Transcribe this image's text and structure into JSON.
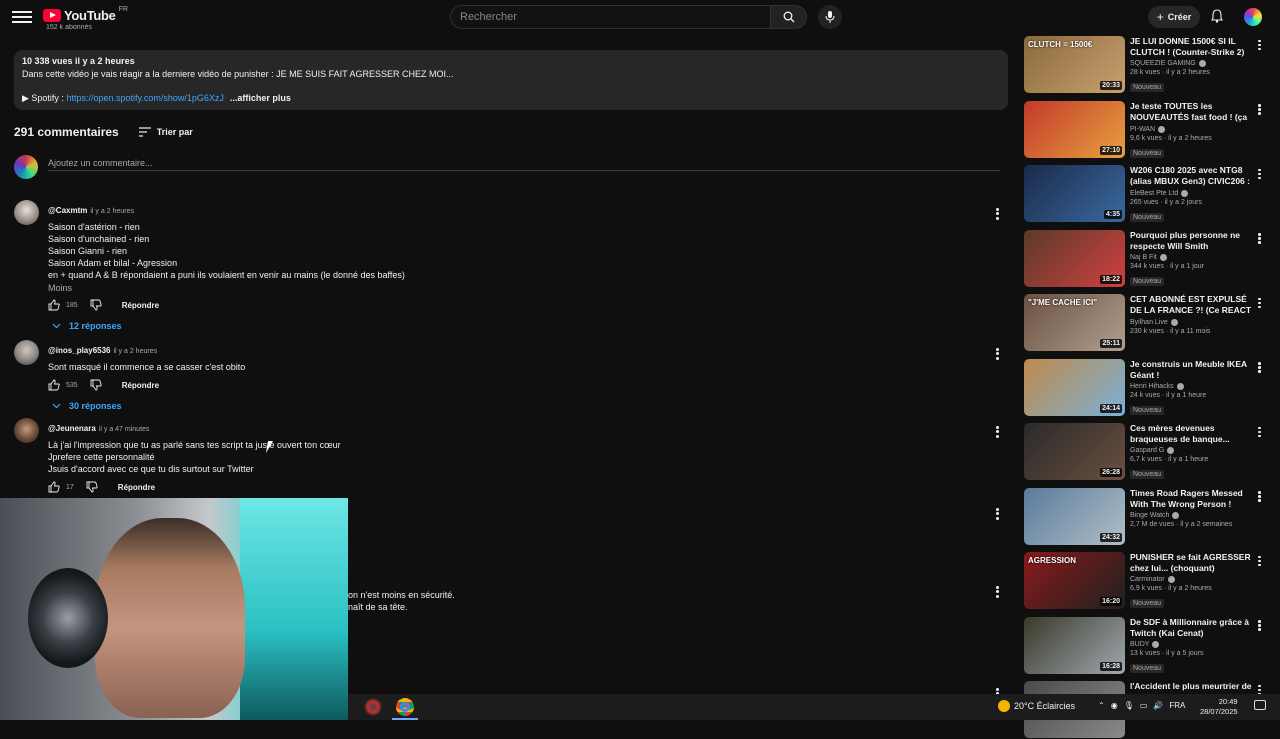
{
  "header": {
    "logo_text": "YouTube",
    "logo_country": "FR",
    "search_placeholder": "Rechercher",
    "create_label": "Créer"
  },
  "channel_strip": {
    "subscribers": "152 k abonnés"
  },
  "description": {
    "meta": "10 338 vues  il y a 2 heures",
    "text": "Dans cette vidéo je vais réagir a la derniere vidéo de punisher : JE ME SUIS FAIT AGRESSER CHEZ MOI...",
    "spotify_label": "▶ Spotify : ",
    "spotify_link": "https://open.spotify.com/show/1pG6XzJ",
    "more": "...afficher plus"
  },
  "comments_header": {
    "count": "291 commentaires",
    "sort_label": "Trier par",
    "add_placeholder": "Ajoutez un commentaire..."
  },
  "comments": [
    {
      "author": "@Caxmtm",
      "time": "il y a 2 heures",
      "lines": [
        "Saison d'astérion - rien",
        "Saison d'unchained - rien",
        "Saison Gianni - rien",
        "Saison Adam et bilal - Agression",
        "en + quand A & B répondaient a puni ils voulaient en venir au mains (le donné des baffes)"
      ],
      "less": "Moins",
      "likes": "185",
      "reply": "Répondre",
      "replies": "12 réponses"
    },
    {
      "author": "@inos_play6536",
      "time": "il y a 2 heures",
      "lines": [
        "Sont masqué il commence a se casser c'est obito"
      ],
      "likes": "535",
      "reply": "Répondre",
      "replies": "30 réponses"
    },
    {
      "author": "@Jeunenara",
      "time": "il y a 47 minutes",
      "lines": [
        "Là j'ai l'impression que tu as parlé sans tes script ta juste ouvert ton cœur",
        "Jprefere cette personnalité",
        "Jsuis d'accord avec ce que tu dis surtout sur Twitter"
      ],
      "likes": "17",
      "reply": "Répondre"
    }
  ],
  "partial_comment": {
    "line1": "on n'est moins en sécurité.",
    "line2": "naît de sa tête."
  },
  "sidebar": [
    {
      "title": "JE LUI DONNE 1500€ SI IL CLUTCH ! (Counter-Strike 2)",
      "channel": "SQUEEZIE GAMING",
      "stats": "28 k vues · il y a 2 heures",
      "badge": "Nouveau",
      "duration": "20:33",
      "thumb_text": "CLUTCH = 1500€",
      "colors": [
        "#8a6a3a",
        "#c9a070"
      ]
    },
    {
      "title": "Je teste TOUTES les NOUVEAUTÉS fast food ! (ça v...",
      "channel": "PI-WAN",
      "stats": "9,6 k vues · il y a 2 heures",
      "badge": "Nouveau",
      "duration": "27:10",
      "thumb_text": "",
      "colors": [
        "#c23a2a",
        "#e8a040"
      ]
    },
    {
      "title": "W206 C180 2025 avec NTG8 (alias MBUX Gen3) CIVIC206 : ...",
      "channel": "EleBest Pte Ltd",
      "stats": "265 vues · il y a 2 jours",
      "badge": "Nouveau",
      "duration": "4:35",
      "thumb_text": "",
      "colors": [
        "#1a2a4a",
        "#3a6aa0"
      ]
    },
    {
      "title": "Pourquoi plus personne ne respecte Will Smith",
      "channel": "Naj B Fit",
      "stats": "344 k vues · il y a 1 jour",
      "badge": "Nouveau",
      "duration": "18:22",
      "thumb_text": "",
      "colors": [
        "#5a3a2a",
        "#d04040"
      ]
    },
    {
      "title": "CET ABONNÉ EST EXPULSÉ DE LA FRANCE ?! (Ce REACT ...",
      "channel": "Byilhan Live",
      "stats": "230 k vues · il y a 11 mois",
      "badge": "",
      "duration": "25:11",
      "thumb_text": "\"J'ME CACHE ICI\"",
      "colors": [
        "#6a5040",
        "#b0a090"
      ]
    },
    {
      "title": "Je construis un Meuble IKEA Géant !",
      "channel": "Henri Hihacks",
      "stats": "24 k vues · il y a 1 heure",
      "badge": "Nouveau",
      "duration": "24:14",
      "thumb_text": "",
      "colors": [
        "#c08a4a",
        "#7ab0d8"
      ]
    },
    {
      "title": "Ces mères devenues braqueuses de banque...",
      "channel": "Gaspard G",
      "stats": "6,7 k vues · il y a 1 heure",
      "badge": "Nouveau",
      "duration": "26:28",
      "thumb_text": "",
      "colors": [
        "#2a2a2a",
        "#6a5040"
      ]
    },
    {
      "title": "Times Road Ragers Messed With The Wrong Person !",
      "channel": "Binge Watch",
      "stats": "2,7 M de vues · il y a 2 semaines",
      "badge": "",
      "duration": "24:32",
      "thumb_text": "",
      "colors": [
        "#5a7a9a",
        "#b0c0c8"
      ]
    },
    {
      "title": "PUNISHER se fait AGRESSER chez lui... (choquant)",
      "channel": "Carminator",
      "stats": "6,9 k vues · il y a 2 heures",
      "badge": "Nouveau",
      "duration": "16:20",
      "thumb_text": "AGRESSION",
      "colors": [
        "#8a1a1a",
        "#202020"
      ]
    },
    {
      "title": "De SDF à Millionnaire grâce à Twitch (Kai Cenat)",
      "channel": "BUDY",
      "stats": "13 k vues · il y a 5 jours",
      "badge": "Nouveau",
      "duration": "16:28",
      "thumb_text": "",
      "colors": [
        "#3a3a2a",
        "#a0a8b0"
      ]
    },
    {
      "title": "l'Accident le plus meurtrier de",
      "channel": "",
      "stats": "",
      "badge": "",
      "duration": "",
      "thumb_text": "",
      "colors": [
        "#4a4a4a",
        "#8a8a8a"
      ]
    }
  ],
  "taskbar": {
    "weather": "20°C  Éclaircies",
    "lang": "FRA",
    "time": "20:49",
    "date": "28/07/2025"
  }
}
